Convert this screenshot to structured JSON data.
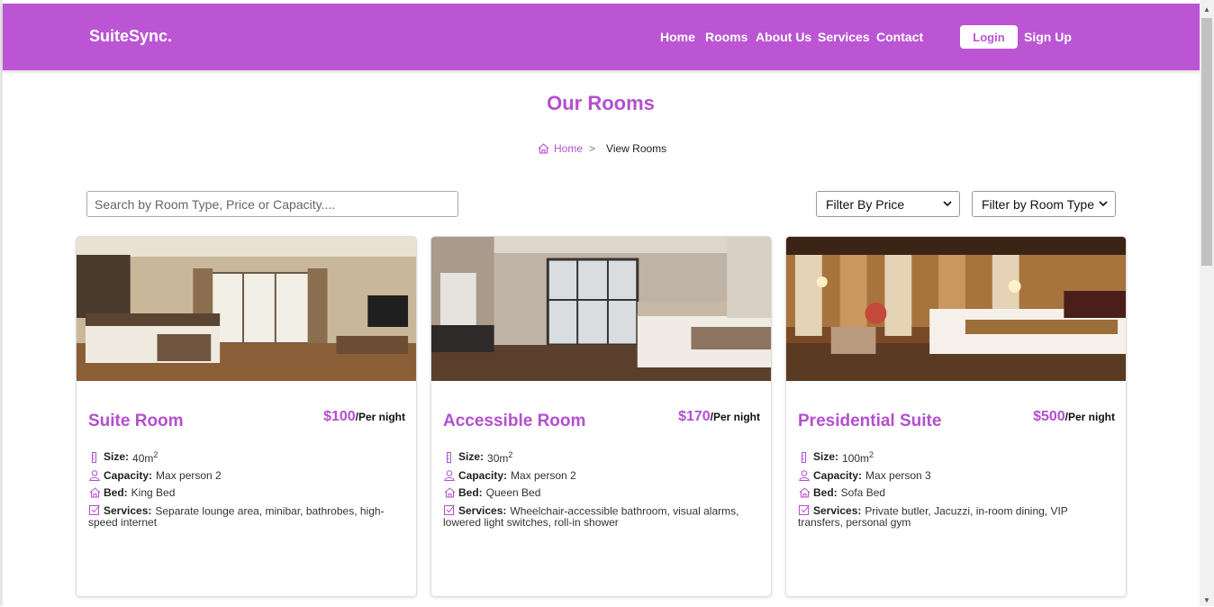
{
  "nav": {
    "brand": "SuiteSync.",
    "links": [
      "Home",
      "Rooms",
      "About Us",
      "Services",
      "Contact"
    ],
    "login": "Login",
    "signup": "Sign Up"
  },
  "page": {
    "title": "Our Rooms",
    "breadcrumb": {
      "home": "Home",
      "separator": ">",
      "current": "View Rooms"
    }
  },
  "search": {
    "placeholder": "Search by Room Type, Price or Capacity...."
  },
  "filters": {
    "price": "Filter By Price",
    "room_type": "Filter by Room Type"
  },
  "labels": {
    "size": "Size:",
    "capacity": "Capacity:",
    "bed": "Bed:",
    "services": "Services:",
    "unit_suffix": "/Per night"
  },
  "rooms": [
    {
      "title": "Suite Room",
      "price": "$100",
      "size": "40m",
      "size_exp": "2",
      "capacity": "Max person 2",
      "bed": "King Bed",
      "services": "Separate lounge area, minibar, bathrobes, high-speed internet"
    },
    {
      "title": "Accessible Room",
      "price": "$170",
      "size": "30m",
      "size_exp": "2",
      "capacity": "Max person 2",
      "bed": "Queen Bed",
      "services": "Wheelchair-accessible bathroom, visual alarms, lowered light switches, roll-in shower"
    },
    {
      "title": "Presidential Suite",
      "price": "$500",
      "size": "100m",
      "size_exp": "2",
      "capacity": "Max person 3",
      "bed": "Sofa Bed",
      "services": "Private butler, Jacuzzi, in-room dining, VIP transfers, personal gym"
    }
  ],
  "colors": {
    "brand": "#bb55d4",
    "accent_text": "#b44fcf"
  }
}
